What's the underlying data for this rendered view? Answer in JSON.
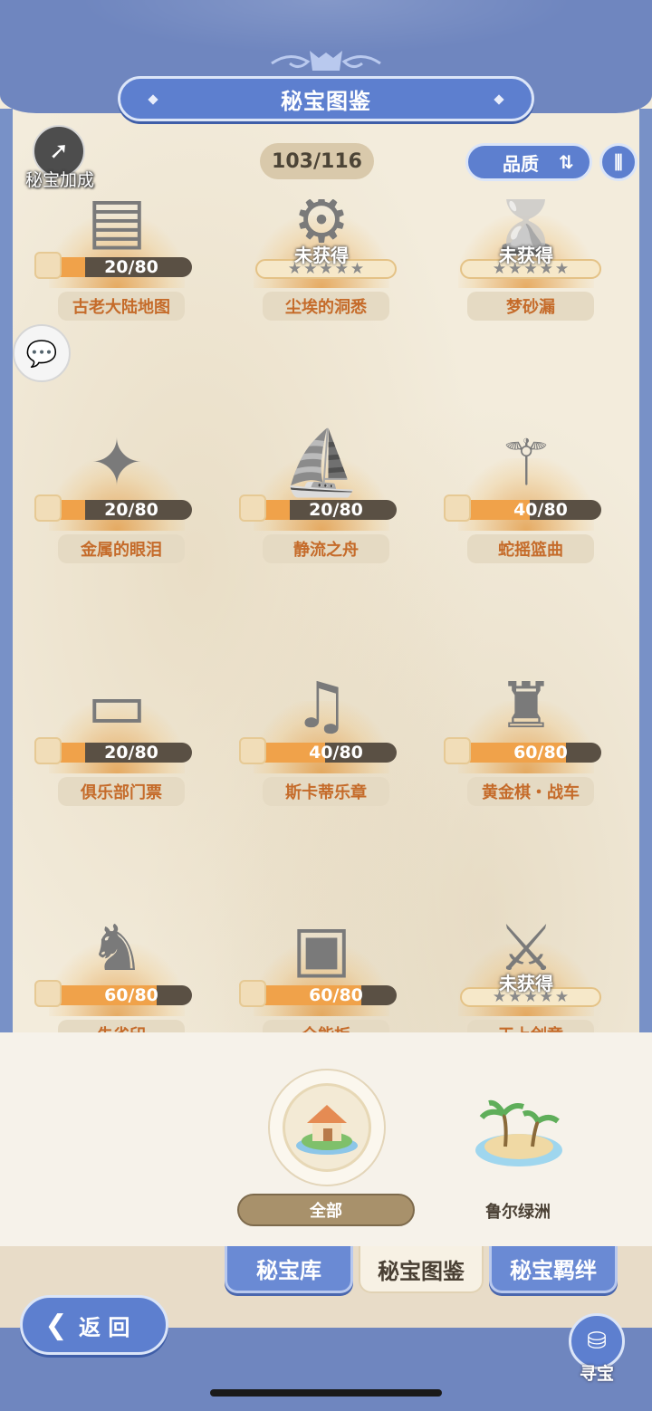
{
  "header": {
    "title": "秘宝图鉴"
  },
  "toolbar": {
    "bonus_label": "秘宝加成",
    "collection_count": "103/116",
    "quality_label": "品质",
    "sort_icon": "sort-toggle-icon"
  },
  "unobtained_text": "未获得",
  "treasures": [
    {
      "name": "古老大陆地图",
      "progress": "20/80",
      "fraction": 0.25,
      "obtained": true,
      "icon": "map-book-icon"
    },
    {
      "name": "尘埃的洞悉",
      "progress": "",
      "fraction": 0,
      "obtained": false,
      "icon": "gear-mirror-icon"
    },
    {
      "name": "梦砂漏",
      "progress": "",
      "fraction": 0,
      "obtained": false,
      "icon": "hourglass-icon"
    },
    {
      "name": "金属的眼泪",
      "progress": "20/80",
      "fraction": 0.25,
      "obtained": true,
      "icon": "metal-tear-icon"
    },
    {
      "name": "静流之舟",
      "progress": "20/80",
      "fraction": 0.25,
      "obtained": true,
      "icon": "boat-icon"
    },
    {
      "name": "蛇摇篮曲",
      "progress": "40/80",
      "fraction": 0.5,
      "obtained": true,
      "icon": "flute-icon"
    },
    {
      "name": "俱乐部门票",
      "progress": "20/80",
      "fraction": 0.25,
      "obtained": true,
      "icon": "ticket-icon"
    },
    {
      "name": "斯卡蒂乐章",
      "progress": "40/80",
      "fraction": 0.5,
      "obtained": true,
      "icon": "lyre-icon"
    },
    {
      "name": "黄金棋・战车",
      "progress": "60/80",
      "fraction": 0.75,
      "obtained": true,
      "icon": "chess-rook-icon"
    },
    {
      "name": "朱雀印",
      "progress": "60/80",
      "fraction": 0.75,
      "obtained": true,
      "icon": "phoenix-seal-icon"
    },
    {
      "name": "全能板",
      "progress": "60/80",
      "fraction": 0.75,
      "obtained": true,
      "icon": "board-icon"
    },
    {
      "name": "天上剑章",
      "progress": "",
      "fraction": 0,
      "obtained": false,
      "icon": "sword-emblem-icon"
    }
  ],
  "regions": [
    {
      "label": "全部",
      "selected": true,
      "icon": "house-island-icon"
    },
    {
      "label": "鲁尔绿洲",
      "selected": false,
      "icon": "palm-island-icon"
    }
  ],
  "tabs": [
    {
      "label": "秘宝库",
      "active": false
    },
    {
      "label": "秘宝图鉴",
      "active": true
    },
    {
      "label": "秘宝羁绊",
      "active": false
    }
  ],
  "footer": {
    "back_label": "返 回",
    "treasure_hunt_label": "寻宝"
  },
  "colors": {
    "accent_blue": "#5d7fcf",
    "progress_fill": "#f0a24a",
    "name_text": "#c56b2a"
  }
}
